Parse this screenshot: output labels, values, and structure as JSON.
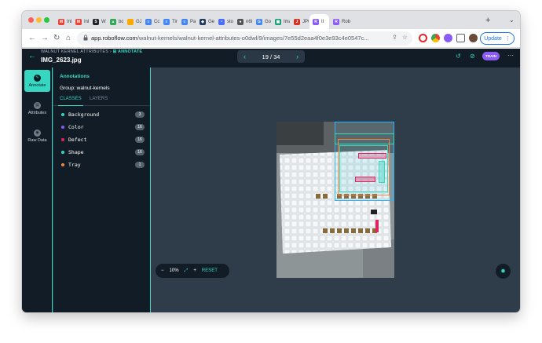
{
  "browser": {
    "tabs": [
      {
        "label": "Inbo",
        "icon": "gmail-icon",
        "color": "#ea4335",
        "glyph": "M"
      },
      {
        "label": "Inbo",
        "icon": "gmail-icon",
        "color": "#ea4335",
        "glyph": "M"
      },
      {
        "label": "Wha",
        "icon": "app-icon",
        "color": "#202124",
        "glyph": "S"
      },
      {
        "label": "bord",
        "icon": "drive-icon",
        "color": "#34a853",
        "glyph": "▲"
      },
      {
        "label": "GJ A",
        "icon": "folder-icon",
        "color": "#f9ab00",
        "glyph": ""
      },
      {
        "label": "Corp",
        "icon": "docs-icon",
        "color": "#4285f4",
        "glyph": "≡"
      },
      {
        "label": "Time",
        "icon": "docs-icon",
        "color": "#4285f4",
        "glyph": "≡"
      },
      {
        "label": "Page",
        "icon": "docs-icon",
        "color": "#4285f4",
        "glyph": "≡"
      },
      {
        "label": "Geo",
        "icon": "site-icon",
        "color": "#1f3a5f",
        "glyph": "◆"
      },
      {
        "label": "stow",
        "icon": "site-icon",
        "color": "#4a6cf7",
        "glyph": "~"
      },
      {
        "label": "n68",
        "icon": "github-icon",
        "color": "#555",
        "glyph": "●"
      },
      {
        "label": "Goo",
        "icon": "translate-icon",
        "color": "#4285f4",
        "glyph": "G"
      },
      {
        "label": "Imag",
        "icon": "image-icon",
        "color": "#1b9e77",
        "glyph": "▣"
      },
      {
        "label": "JPG",
        "icon": "jpg-icon",
        "color": "#d93025",
        "glyph": "J"
      },
      {
        "label": "II",
        "icon": "roboflow-icon",
        "color": "#8a5cf5",
        "glyph": "R"
      },
      {
        "label": "Rob",
        "icon": "roboflow-icon",
        "color": "#8a5cf5",
        "glyph": "R"
      }
    ],
    "url_host": "app.roboflow.com",
    "url_path": "/walnut-kernels/walnut-kernel-attributes-o0dwl/9/images/7e55d2eaa4f0e3e93c4e0547c...",
    "update_label": "Update"
  },
  "app": {
    "breadcrumb_project": "WALNUT KERNEL ATTRIBUTES",
    "breadcrumb_sep": "›",
    "breadcrumb_mode": "ANNOTATE",
    "filename": "IMG_2623.jpg",
    "pager_text": "19 / 34",
    "train_label": "TRAIN",
    "rail": [
      {
        "label": "Annotate",
        "icon": "annotate-icon"
      },
      {
        "label": "Attributes",
        "icon": "attributes-icon"
      },
      {
        "label": "Raw Data",
        "icon": "raw-data-icon"
      }
    ],
    "panel_title": "Annotations",
    "group_label": "Group: walnut-kernels",
    "tab_classes": "CLASSES",
    "tab_layers": "LAYERS",
    "classes": [
      {
        "name": "Background",
        "count": "3",
        "color": "#35d7c0"
      },
      {
        "name": "Color",
        "count": "16",
        "color": "#8a5cf5"
      },
      {
        "name": "Defect",
        "count": "16",
        "color": "#e0245e"
      },
      {
        "name": "Shape",
        "count": "16",
        "color": "#35d7c0"
      },
      {
        "name": "Tray",
        "count": "1",
        "color": "#f08a3e"
      }
    ],
    "zoom_minus": "−",
    "zoom_level": "10%",
    "zoom_plus": "+",
    "zoom_reset": "RESET"
  }
}
